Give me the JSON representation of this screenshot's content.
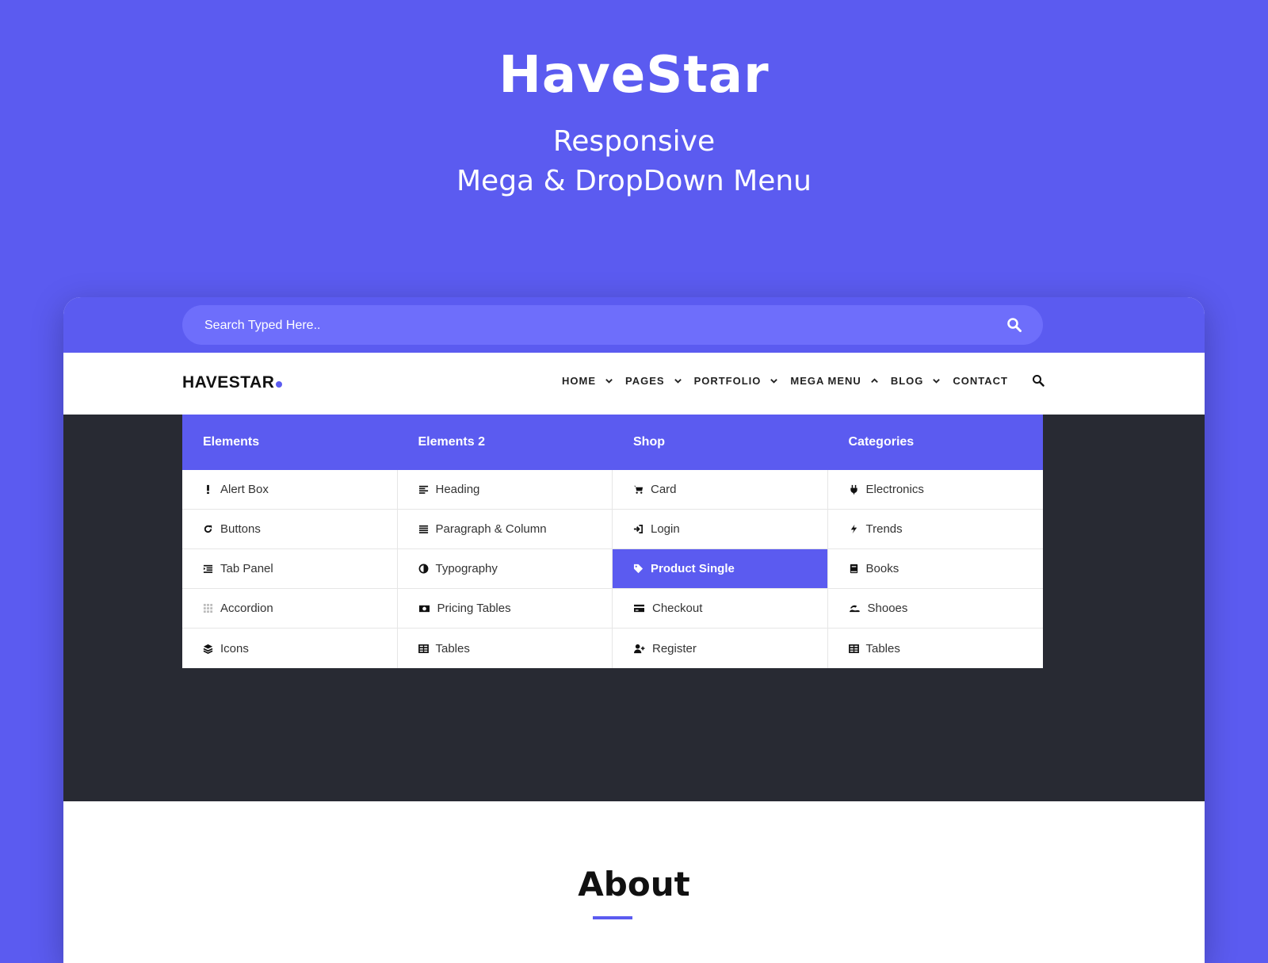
{
  "hero": {
    "title": "HaveStar",
    "subtitle_line1": "Responsive",
    "subtitle_line2": "Mega & DropDown Menu"
  },
  "search": {
    "placeholder": "Search Typed Here.."
  },
  "navbar": {
    "logo": "HAVESTAR",
    "items": [
      {
        "label": "HOME",
        "chevron": "down"
      },
      {
        "label": "PAGES",
        "chevron": "down"
      },
      {
        "label": "PORTFOLIO",
        "chevron": "down"
      },
      {
        "label": "MEGA MENU",
        "chevron": "up"
      },
      {
        "label": "BLOG",
        "chevron": "down"
      },
      {
        "label": "CONTACT"
      }
    ]
  },
  "mega_menu": {
    "columns": [
      {
        "heading": "Elements",
        "items": [
          {
            "label": "Alert Box",
            "icon": "exclamation-icon"
          },
          {
            "label": "Buttons",
            "icon": "refresh-icon"
          },
          {
            "label": "Tab Panel",
            "icon": "list-indent-icon"
          },
          {
            "label": "Accordion",
            "icon": "grid-dots-icon"
          },
          {
            "label": "Icons",
            "icon": "layers-icon"
          }
        ]
      },
      {
        "heading": "Elements 2",
        "items": [
          {
            "label": "Heading",
            "icon": "align-left-icon"
          },
          {
            "label": "Paragraph & Column",
            "icon": "align-justify-icon"
          },
          {
            "label": "Typography",
            "icon": "contrast-icon"
          },
          {
            "label": "Pricing Tables",
            "icon": "money-icon"
          },
          {
            "label": "Tables",
            "icon": "table-icon"
          }
        ]
      },
      {
        "heading": "Shop",
        "items": [
          {
            "label": "Card",
            "icon": "cart-icon"
          },
          {
            "label": "Login",
            "icon": "sign-in-icon"
          },
          {
            "label": "Product Single",
            "icon": "tag-icon",
            "active": true
          },
          {
            "label": "Checkout",
            "icon": "credit-card-icon"
          },
          {
            "label": "Register",
            "icon": "user-plus-icon"
          }
        ]
      },
      {
        "heading": "Categories",
        "items": [
          {
            "label": "Electronics",
            "icon": "plug-icon"
          },
          {
            "label": "Trends",
            "icon": "bolt-icon"
          },
          {
            "label": "Books",
            "icon": "book-icon"
          },
          {
            "label": "Shooes",
            "icon": "shoe-icon"
          },
          {
            "label": "Tables",
            "icon": "table-icon"
          }
        ]
      }
    ]
  },
  "about": {
    "title": "About"
  },
  "colors": {
    "accent": "#5b5bf0",
    "dark_band": "#282a33",
    "search_field": "#6e6efb"
  }
}
